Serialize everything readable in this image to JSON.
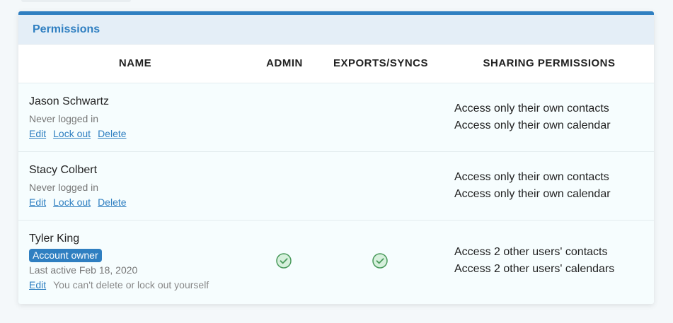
{
  "panel": {
    "title": "Permissions"
  },
  "columns": {
    "name": "NAME",
    "admin": "ADMIN",
    "exports": "EXPORTS/SYNCS",
    "sharing": "SHARING PERMISSIONS"
  },
  "users": [
    {
      "name": "Jason Schwartz",
      "status": "Never logged in",
      "actions": {
        "edit": "Edit",
        "lock_out": "Lock out",
        "delete": "Delete"
      },
      "admin": false,
      "exports": false,
      "sharing": [
        "Access only their own contacts",
        "Access only their own calendar"
      ]
    },
    {
      "name": "Stacy Colbert",
      "status": "Never logged in",
      "actions": {
        "edit": "Edit",
        "lock_out": "Lock out",
        "delete": "Delete"
      },
      "admin": false,
      "exports": false,
      "sharing": [
        "Access only their own contacts",
        "Access only their own calendar"
      ]
    },
    {
      "name": "Tyler King",
      "badge": "Account owner",
      "status": "Last active Feb 18, 2020",
      "actions": {
        "edit": "Edit",
        "note": "You can't delete or lock out yourself"
      },
      "admin": true,
      "exports": true,
      "sharing": [
        "Access 2 other users' contacts",
        "Access 2 other users' calendars"
      ]
    }
  ],
  "colors": {
    "accent": "#2f7fc1",
    "check_fill": "#d6f0dc",
    "check_stroke": "#4a9a5c"
  },
  "icons": {
    "admin_check": "check-circle-icon",
    "exports_check": "check-circle-icon"
  }
}
